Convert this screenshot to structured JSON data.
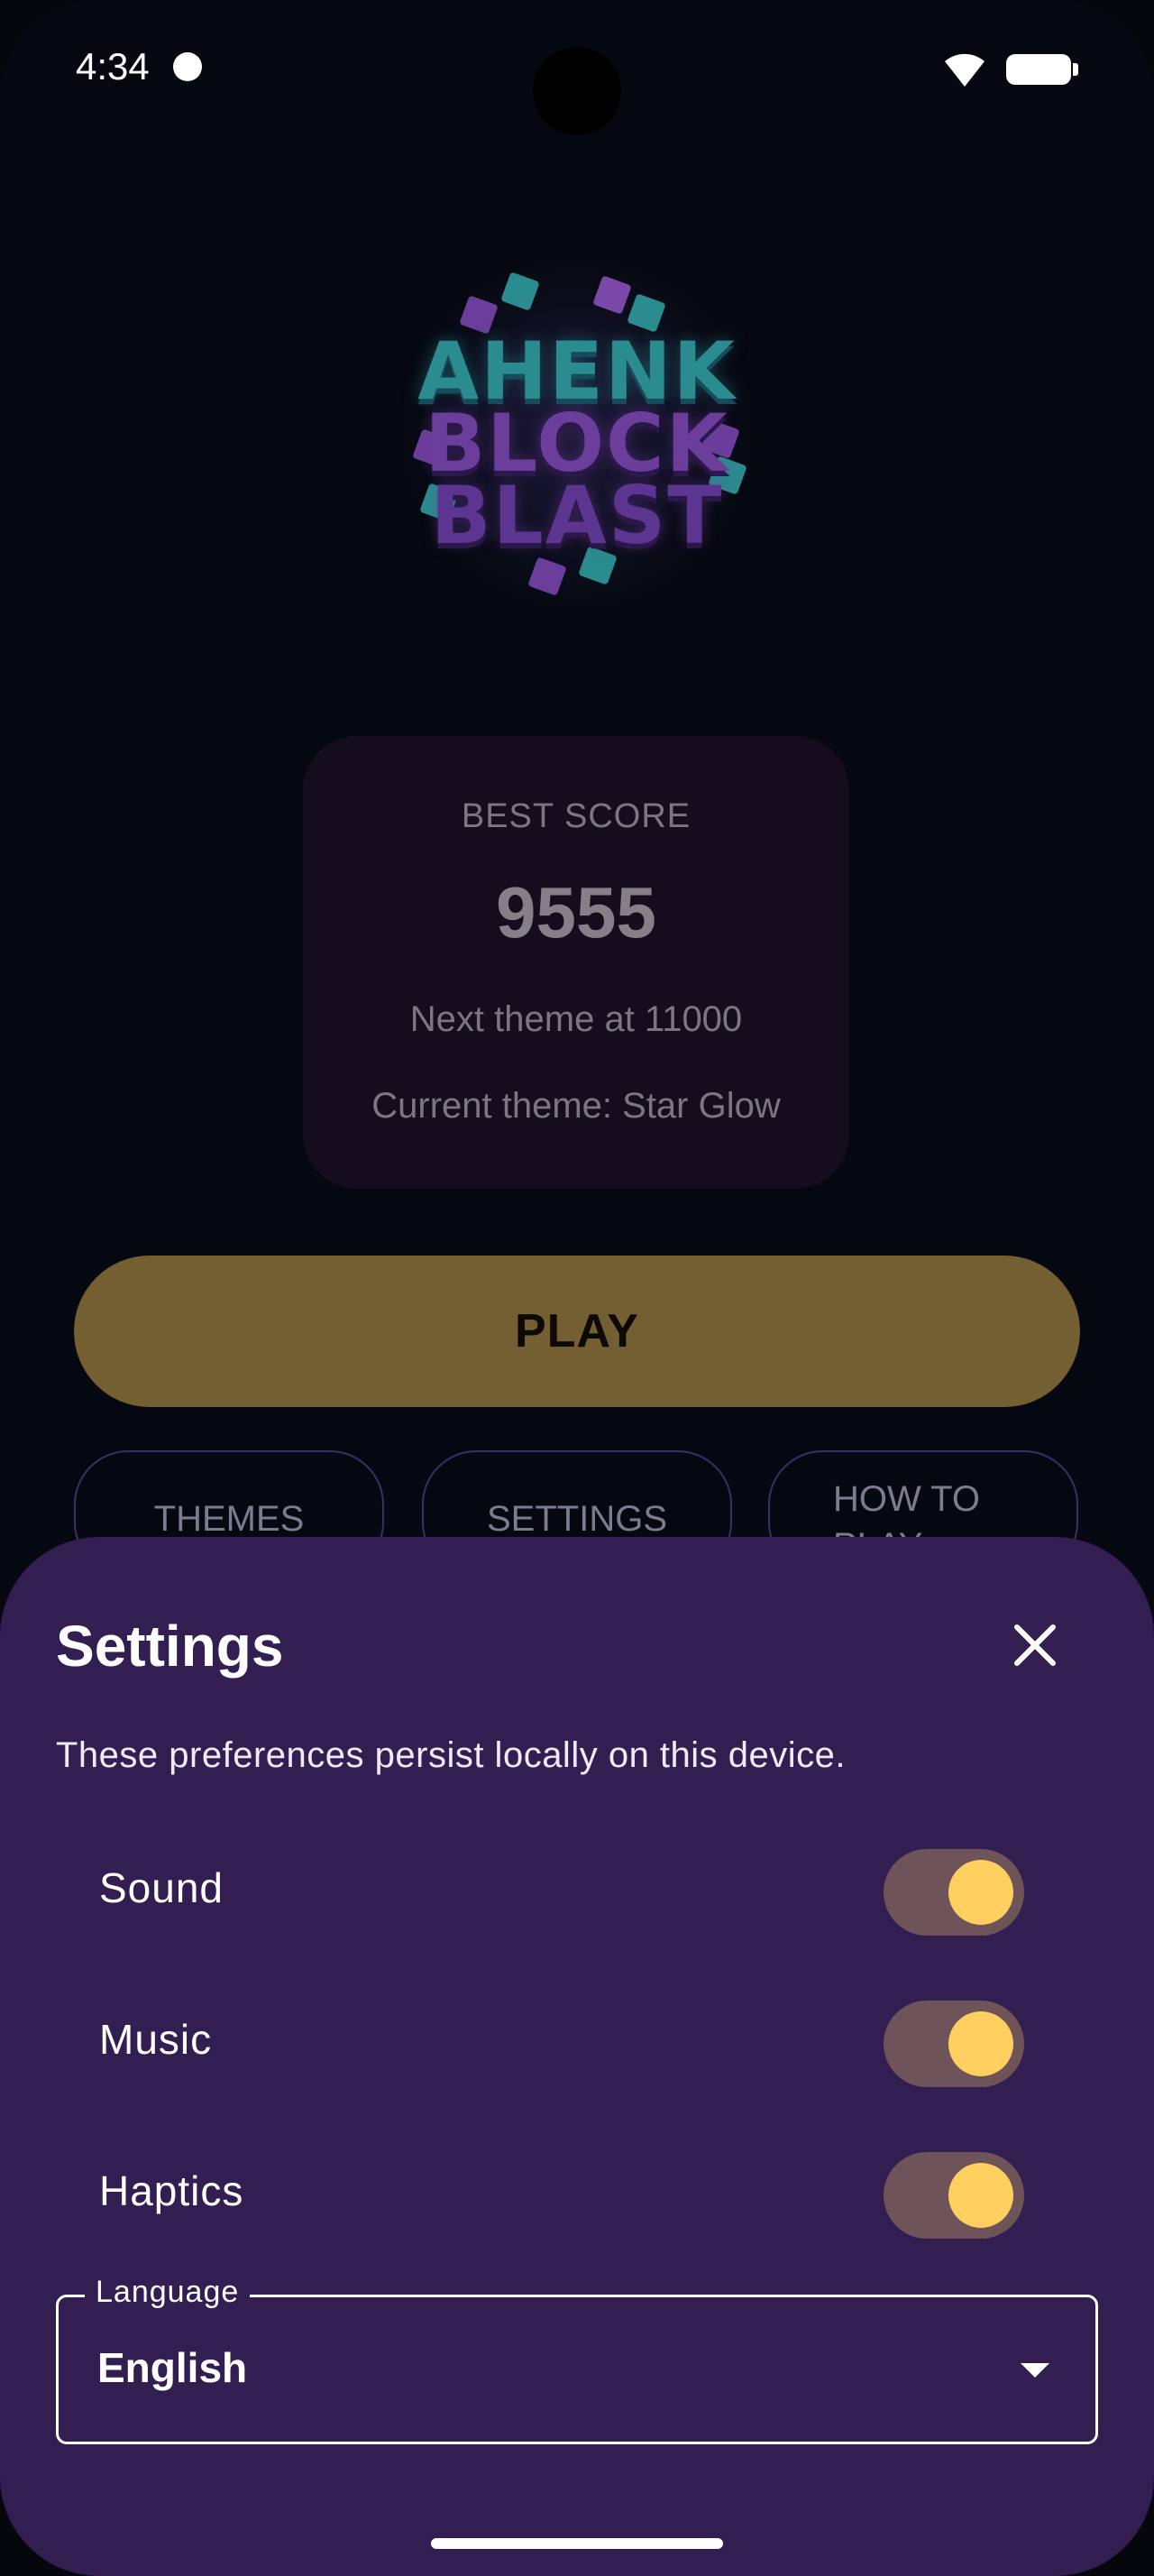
{
  "status_bar": {
    "time": "4:34"
  },
  "logo": {
    "line1": "AHENK",
    "line2": "BLOCK",
    "line3": "BLAST"
  },
  "score_card": {
    "label": "BEST SCORE",
    "value": "9555",
    "next_theme": "Next theme at 11000",
    "current_theme": "Current theme: Star Glow"
  },
  "play_button": {
    "label": "PLAY"
  },
  "secondary_buttons": {
    "themes": "THEMES",
    "settings": "SETTINGS",
    "how_to_play": "HOW TO PLAY"
  },
  "settings_sheet": {
    "title": "Settings",
    "description": "These preferences persist locally on this device.",
    "toggles": [
      {
        "label": "Sound",
        "on": true
      },
      {
        "label": "Music",
        "on": true
      },
      {
        "label": "Haptics",
        "on": true
      }
    ],
    "language": {
      "label": "Language",
      "value": "English"
    }
  },
  "colors": {
    "accent": "#ffd060",
    "sheet_bg": "#321e50",
    "play_bg": "#735f31"
  }
}
